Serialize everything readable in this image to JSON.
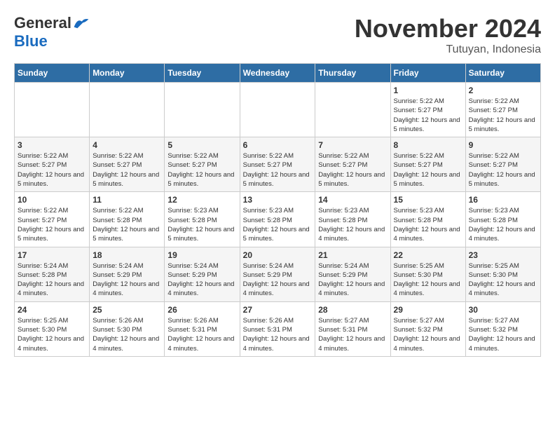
{
  "logo": {
    "general": "General",
    "blue": "Blue"
  },
  "header": {
    "month": "November 2024",
    "location": "Tutuyan, Indonesia"
  },
  "days_of_week": [
    "Sunday",
    "Monday",
    "Tuesday",
    "Wednesday",
    "Thursday",
    "Friday",
    "Saturday"
  ],
  "weeks": [
    [
      {
        "day": "",
        "info": ""
      },
      {
        "day": "",
        "info": ""
      },
      {
        "day": "",
        "info": ""
      },
      {
        "day": "",
        "info": ""
      },
      {
        "day": "",
        "info": ""
      },
      {
        "day": "1",
        "info": "Sunrise: 5:22 AM\nSunset: 5:27 PM\nDaylight: 12 hours and 5 minutes."
      },
      {
        "day": "2",
        "info": "Sunrise: 5:22 AM\nSunset: 5:27 PM\nDaylight: 12 hours and 5 minutes."
      }
    ],
    [
      {
        "day": "3",
        "info": "Sunrise: 5:22 AM\nSunset: 5:27 PM\nDaylight: 12 hours and 5 minutes."
      },
      {
        "day": "4",
        "info": "Sunrise: 5:22 AM\nSunset: 5:27 PM\nDaylight: 12 hours and 5 minutes."
      },
      {
        "day": "5",
        "info": "Sunrise: 5:22 AM\nSunset: 5:27 PM\nDaylight: 12 hours and 5 minutes."
      },
      {
        "day": "6",
        "info": "Sunrise: 5:22 AM\nSunset: 5:27 PM\nDaylight: 12 hours and 5 minutes."
      },
      {
        "day": "7",
        "info": "Sunrise: 5:22 AM\nSunset: 5:27 PM\nDaylight: 12 hours and 5 minutes."
      },
      {
        "day": "8",
        "info": "Sunrise: 5:22 AM\nSunset: 5:27 PM\nDaylight: 12 hours and 5 minutes."
      },
      {
        "day": "9",
        "info": "Sunrise: 5:22 AM\nSunset: 5:27 PM\nDaylight: 12 hours and 5 minutes."
      }
    ],
    [
      {
        "day": "10",
        "info": "Sunrise: 5:22 AM\nSunset: 5:27 PM\nDaylight: 12 hours and 5 minutes."
      },
      {
        "day": "11",
        "info": "Sunrise: 5:22 AM\nSunset: 5:28 PM\nDaylight: 12 hours and 5 minutes."
      },
      {
        "day": "12",
        "info": "Sunrise: 5:23 AM\nSunset: 5:28 PM\nDaylight: 12 hours and 5 minutes."
      },
      {
        "day": "13",
        "info": "Sunrise: 5:23 AM\nSunset: 5:28 PM\nDaylight: 12 hours and 5 minutes."
      },
      {
        "day": "14",
        "info": "Sunrise: 5:23 AM\nSunset: 5:28 PM\nDaylight: 12 hours and 4 minutes."
      },
      {
        "day": "15",
        "info": "Sunrise: 5:23 AM\nSunset: 5:28 PM\nDaylight: 12 hours and 4 minutes."
      },
      {
        "day": "16",
        "info": "Sunrise: 5:23 AM\nSunset: 5:28 PM\nDaylight: 12 hours and 4 minutes."
      }
    ],
    [
      {
        "day": "17",
        "info": "Sunrise: 5:24 AM\nSunset: 5:28 PM\nDaylight: 12 hours and 4 minutes."
      },
      {
        "day": "18",
        "info": "Sunrise: 5:24 AM\nSunset: 5:29 PM\nDaylight: 12 hours and 4 minutes."
      },
      {
        "day": "19",
        "info": "Sunrise: 5:24 AM\nSunset: 5:29 PM\nDaylight: 12 hours and 4 minutes."
      },
      {
        "day": "20",
        "info": "Sunrise: 5:24 AM\nSunset: 5:29 PM\nDaylight: 12 hours and 4 minutes."
      },
      {
        "day": "21",
        "info": "Sunrise: 5:24 AM\nSunset: 5:29 PM\nDaylight: 12 hours and 4 minutes."
      },
      {
        "day": "22",
        "info": "Sunrise: 5:25 AM\nSunset: 5:30 PM\nDaylight: 12 hours and 4 minutes."
      },
      {
        "day": "23",
        "info": "Sunrise: 5:25 AM\nSunset: 5:30 PM\nDaylight: 12 hours and 4 minutes."
      }
    ],
    [
      {
        "day": "24",
        "info": "Sunrise: 5:25 AM\nSunset: 5:30 PM\nDaylight: 12 hours and 4 minutes."
      },
      {
        "day": "25",
        "info": "Sunrise: 5:26 AM\nSunset: 5:30 PM\nDaylight: 12 hours and 4 minutes."
      },
      {
        "day": "26",
        "info": "Sunrise: 5:26 AM\nSunset: 5:31 PM\nDaylight: 12 hours and 4 minutes."
      },
      {
        "day": "27",
        "info": "Sunrise: 5:26 AM\nSunset: 5:31 PM\nDaylight: 12 hours and 4 minutes."
      },
      {
        "day": "28",
        "info": "Sunrise: 5:27 AM\nSunset: 5:31 PM\nDaylight: 12 hours and 4 minutes."
      },
      {
        "day": "29",
        "info": "Sunrise: 5:27 AM\nSunset: 5:32 PM\nDaylight: 12 hours and 4 minutes."
      },
      {
        "day": "30",
        "info": "Sunrise: 5:27 AM\nSunset: 5:32 PM\nDaylight: 12 hours and 4 minutes."
      }
    ]
  ]
}
